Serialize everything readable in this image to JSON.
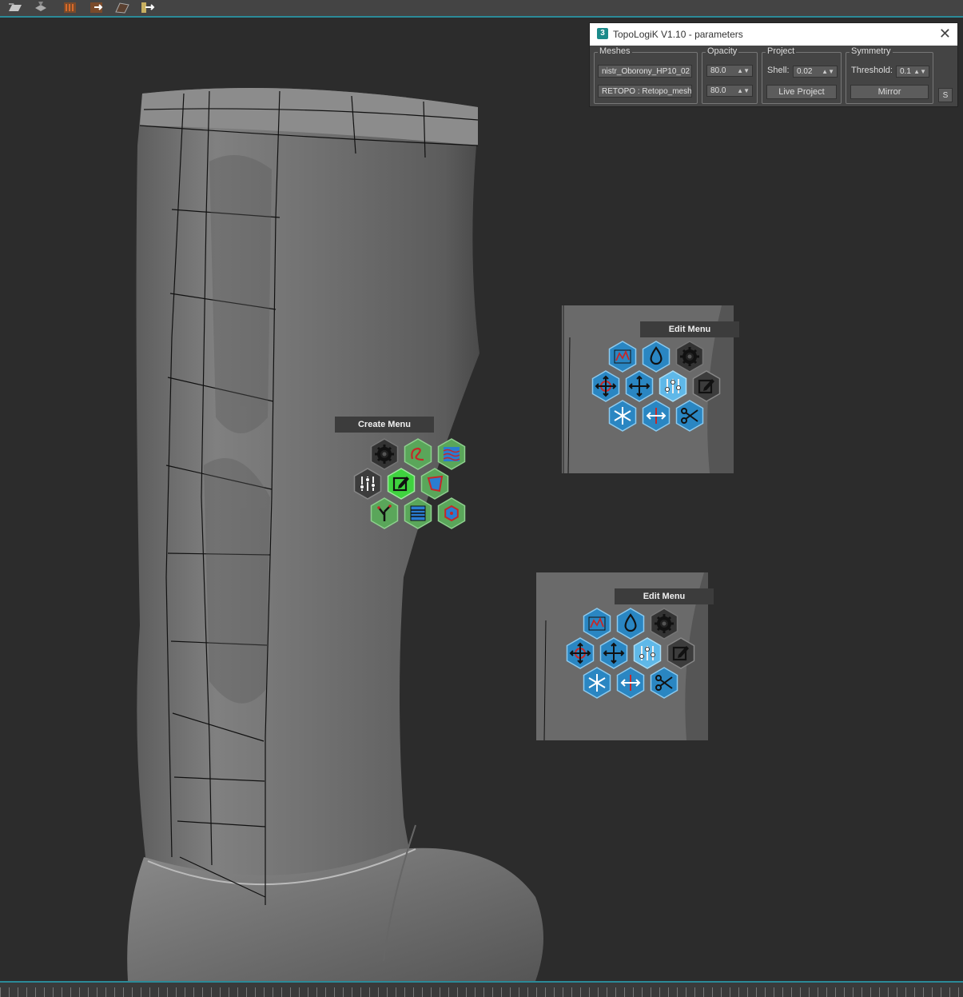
{
  "window": {
    "title": "TopoLogiK  V1.10 - parameters",
    "logo_text": "3"
  },
  "meshes": {
    "label": "Meshes",
    "high_poly": "nistr_Oborony_HP10_02",
    "retopo": "RETOPO : Retopo_mesh"
  },
  "opacity": {
    "label": "Opacity",
    "value1": "80.0",
    "value2": "80.0"
  },
  "project": {
    "label": "Project",
    "shell_label": "Shell:",
    "shell_value": "0.02",
    "live_project_label": "Live  Project"
  },
  "symmetry": {
    "label": "Symmetry",
    "threshold_label": "Threshold:",
    "threshold_value": "0.1",
    "mirror_label": "Mirror"
  },
  "s_button": "S",
  "create_menu": {
    "title": "Create Menu",
    "icons": [
      "gear-icon",
      "draw-stroke-icon",
      "waves-icon",
      "sliders-icon",
      "edit-icon",
      "quad-icon",
      "branch-icon",
      "strips-icon",
      "hexagon-mesh-icon"
    ]
  },
  "edit_menu_1": {
    "title": "Edit Menu",
    "icons": [
      "relax-graph-icon",
      "drop-icon",
      "gear-icon",
      "move-vertex-icon",
      "move-icon",
      "sliders-icon",
      "edit-icon",
      "freeze-icon",
      "slide-icon",
      "cut-icon"
    ]
  },
  "edit_menu_2": {
    "title": "Edit Menu",
    "icons": [
      "relax-graph-icon",
      "drop-icon",
      "gear-icon",
      "move-vertex-icon",
      "move-icon",
      "sliders-icon",
      "edit-icon",
      "freeze-icon",
      "slide-icon",
      "cut-icon"
    ]
  },
  "colors": {
    "accent": "#2b8a98",
    "create_green": "#5aa65a",
    "active_green": "#3fd23f",
    "edit_blue": "#2a86c2",
    "edit_light_blue": "#5fb8e8"
  }
}
